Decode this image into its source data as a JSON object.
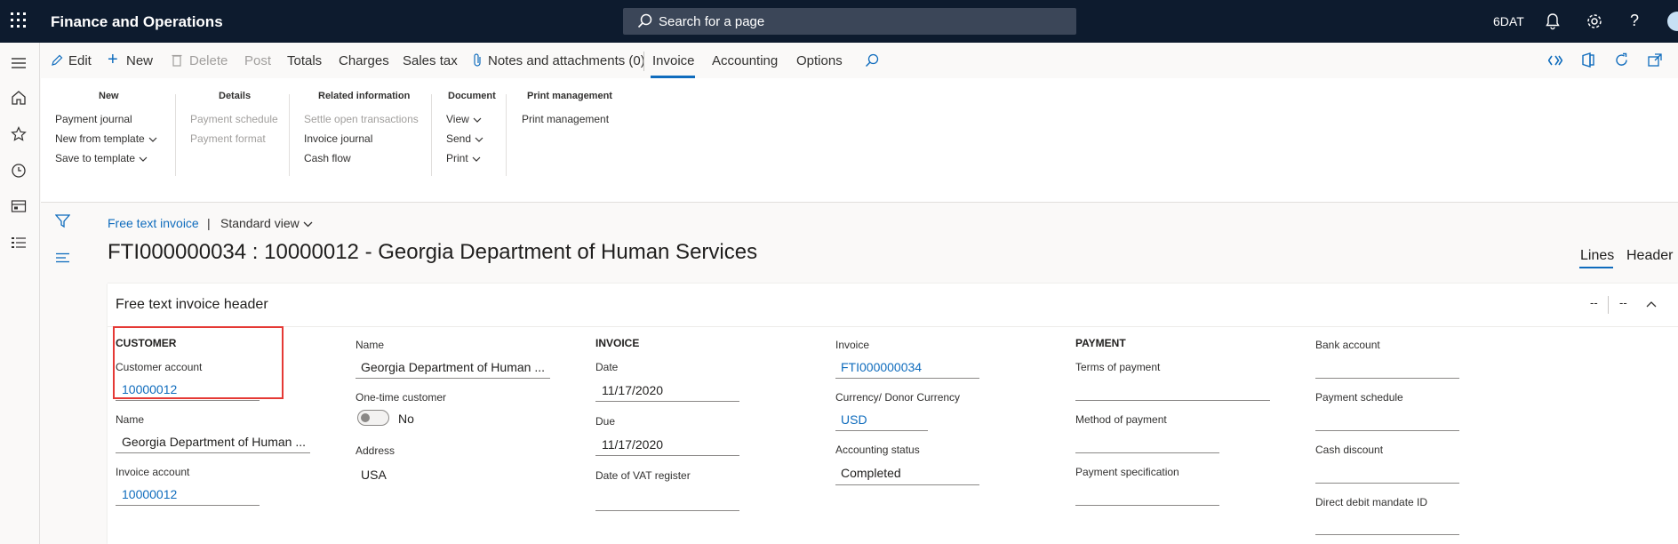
{
  "topbar": {
    "app_title": "Finance and Operations",
    "search_placeholder": "Search for a page",
    "company": "6DAT"
  },
  "actionbar": {
    "edit": "Edit",
    "new": "New",
    "delete": "Delete",
    "post": "Post",
    "totals": "Totals",
    "charges": "Charges",
    "sales_tax": "Sales tax",
    "notes": "Notes and attachments (0)",
    "invoice": "Invoice",
    "accounting": "Accounting",
    "options": "Options"
  },
  "ribbon": {
    "new_group": {
      "title": "New",
      "items": [
        "Payment journal",
        "New from template",
        "Save to template"
      ]
    },
    "details_group": {
      "title": "Details",
      "items": [
        "Payment schedule",
        "Payment format"
      ]
    },
    "related_group": {
      "title": "Related information",
      "items": [
        "Settle open transactions",
        "Invoice journal",
        "Cash flow"
      ]
    },
    "document_group": {
      "title": "Document",
      "items": [
        "View",
        "Send",
        "Print"
      ]
    },
    "print_group": {
      "title": "Print management",
      "items": [
        "Print management"
      ]
    }
  },
  "breadcrumb": {
    "link": "Free text invoice",
    "separator": "|",
    "view": "Standard view"
  },
  "page_title": "FTI000000034 : 10000012 - Georgia Department of Human Services",
  "tabs": {
    "lines": "Lines",
    "header": "Header"
  },
  "card": {
    "title": "Free text invoice header",
    "ctl1": "--",
    "ctl2": "--",
    "customer": {
      "section": "CUSTOMER",
      "account_label": "Customer account",
      "account_value": "10000012",
      "name_label": "Name",
      "name_value": "Georgia Department of Human ...",
      "invoice_account_label": "Invoice account",
      "invoice_account_value": "10000012"
    },
    "col2": {
      "name_label": "Name",
      "name_value": "Georgia Department of Human ...",
      "onetime_label": "One-time customer",
      "onetime_value": "No",
      "address_label": "Address",
      "address_value": "USA"
    },
    "invoice": {
      "section": "INVOICE",
      "date_label": "Date",
      "date_value": "11/17/2020",
      "due_label": "Due",
      "due_value": "11/17/2020",
      "vat_label": "Date of VAT register"
    },
    "col4": {
      "invoice_label": "Invoice",
      "invoice_value": "FTI000000034",
      "currency_label": "Currency/ Donor Currency",
      "currency_value": "USD",
      "status_label": "Accounting status",
      "status_value": "Completed"
    },
    "payment": {
      "section": "PAYMENT",
      "terms_label": "Terms of payment",
      "method_label": "Method of payment",
      "spec_label": "Payment specification"
    },
    "col6": {
      "bank_label": "Bank account",
      "schedule_label": "Payment schedule",
      "discount_label": "Cash discount",
      "mandate_label": "Direct debit mandate ID"
    }
  }
}
